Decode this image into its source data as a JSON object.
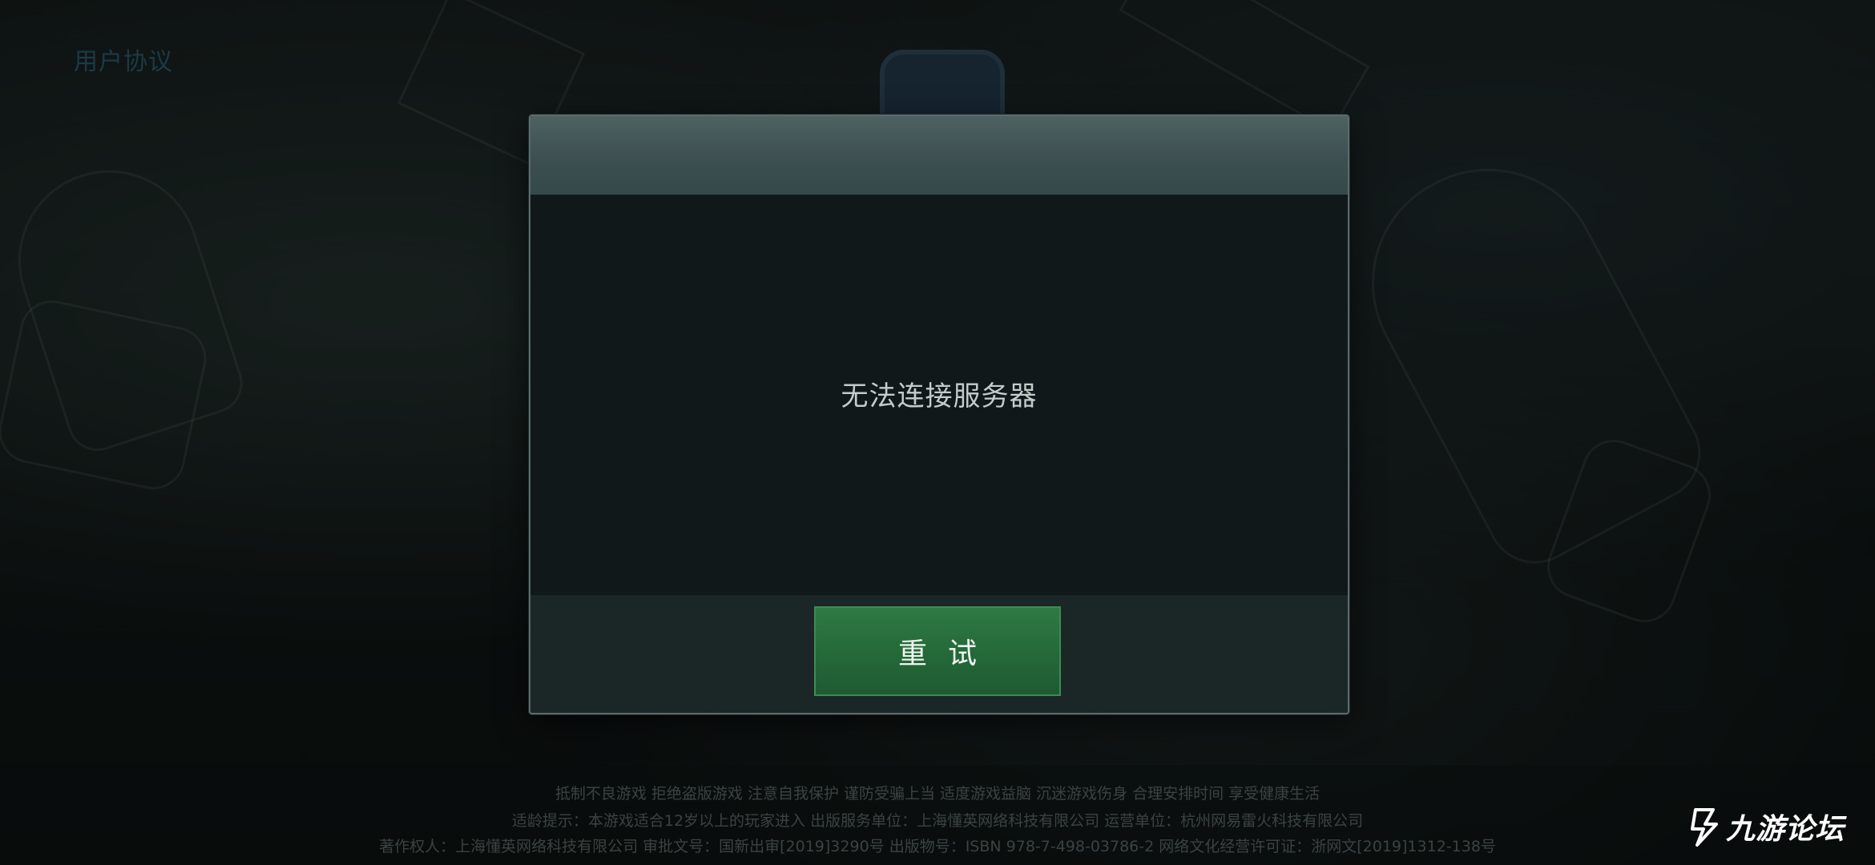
{
  "top_link": {
    "label": "用户协议"
  },
  "dialog": {
    "message": "无法连接服务器",
    "retry_label": "重试"
  },
  "footer": {
    "line1": "抵制不良游戏  拒绝盗版游戏  注意自我保护  谨防受骗上当  适度游戏益脑  沉迷游戏伤身  合理安排时间  享受健康生活",
    "line2": "适龄提示：本游戏适合12岁以上的玩家进入                出版服务单位：上海懂英网络科技有限公司                运营单位：杭州网易雷火科技有限公司",
    "line3": "著作权人：上海懂英网络科技有限公司    审批文号：国新出审[2019]3290号  出版物号：ISBN 978-7-498-03786-2    网络文化经营许可证：浙网文[2019]1312-138号"
  },
  "watermark": {
    "text": "九游论坛",
    "icon": "jiuyou-logo-icon"
  },
  "colors": {
    "retry_button": "#256a3a",
    "dialog_header": "#3d4f50",
    "dialog_body": "#111819"
  }
}
